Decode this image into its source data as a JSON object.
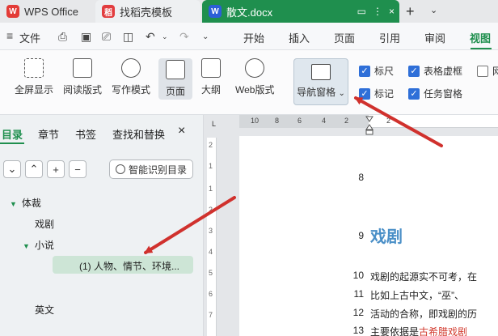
{
  "tabs": [
    {
      "label": "WPS Office"
    },
    {
      "label": "找稻壳模板"
    },
    {
      "label": "散文.docx"
    }
  ],
  "tab_icons": {
    "wps": "W",
    "template": "稻",
    "doc": "W"
  },
  "menubar": {
    "file": "文件",
    "items": [
      "开始",
      "插入",
      "页面",
      "引用",
      "审阅",
      "视图"
    ]
  },
  "ribbon": {
    "buttons": [
      "全屏显示",
      "阅读版式",
      "写作模式",
      "页面",
      "大纲",
      "Web版式"
    ],
    "nav_pane": "导航窗格",
    "nav_pane_caret": "⌄",
    "checks": [
      {
        "label": "标尺",
        "checked": true
      },
      {
        "label": "表格虚框",
        "checked": true
      },
      {
        "label": "网",
        "checked": false
      },
      {
        "label": "标记",
        "checked": true
      },
      {
        "label": "任务窗格",
        "checked": true
      }
    ]
  },
  "left_panel": {
    "tabs": [
      "目录",
      "章节",
      "书签",
      "查找和替换"
    ],
    "close": "×",
    "controls": [
      "⌄",
      "⌃",
      "+",
      "−"
    ],
    "smart_toc": "智能识别目录",
    "toc": [
      {
        "label": "体裁",
        "expandable": true
      },
      {
        "label": "戏剧",
        "expandable": false
      },
      {
        "label": "小说",
        "expandable": true
      },
      {
        "label": "(1) 人物、情节、环境...",
        "expandable": false,
        "selected": true
      },
      {
        "label": "英文",
        "expandable": false
      }
    ]
  },
  "ruler": {
    "h_ticks": [
      "10",
      "8",
      "6",
      "4",
      "2",
      "2"
    ],
    "v_ticks": [
      "2",
      "1",
      "1",
      "2",
      "3",
      "4",
      "5",
      "6",
      "7"
    ],
    "corner": "L"
  },
  "document": {
    "heading": "戏剧",
    "heading_num": "9",
    "line8_num": "8",
    "lines": [
      {
        "num": "10",
        "text": "戏剧的起源实不可考，在"
      },
      {
        "num": "11",
        "text": "比如上古中文，“巫”、"
      },
      {
        "num": "12",
        "text": "活动的合称，即戏剧的历"
      },
      {
        "num": "13",
        "text_a": "主要依据是",
        "text_b": "古希腊戏剧"
      }
    ]
  },
  "colors": {
    "accent": "#1f8f4e",
    "heading": "#4a8fc7",
    "arrow": "#d0312d",
    "checkbox": "#2f6fd8"
  }
}
